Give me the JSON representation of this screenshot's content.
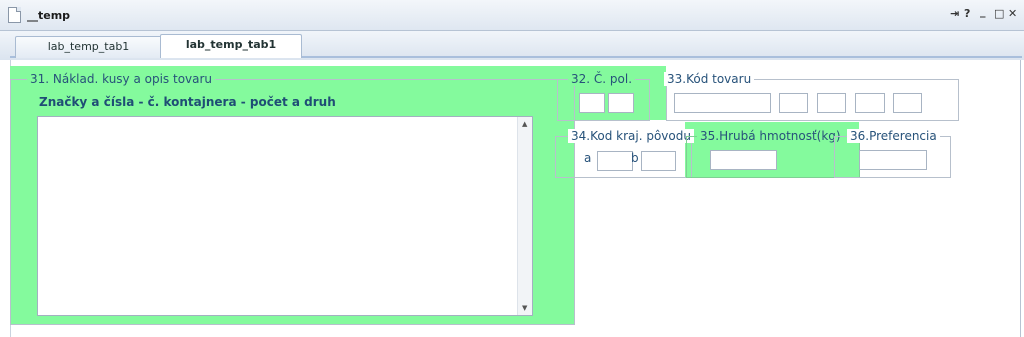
{
  "window": {
    "title": "__temp",
    "controls": [
      "⇥",
      "?",
      "_",
      "□",
      "✕"
    ]
  },
  "tabs": [
    {
      "label": "lab_temp_tab1",
      "active": false
    },
    {
      "label": "lab_temp_tab1",
      "active": true
    }
  ],
  "form": {
    "box31": {
      "legend": "31. Náklad. kusy a opis tovaru",
      "sublabel": "Značky a čísla - č. kontajnera - počet a druh",
      "value": ""
    },
    "box32": {
      "legend": "32. Č. pol."
    },
    "box33": {
      "legend": "33.Kód tovaru"
    },
    "box34": {
      "legend": "34.Kod kraj. pôvodu",
      "a_label": "a",
      "b_label": "b"
    },
    "box35": {
      "legend": "35.Hrubá hmotnosť(kg)"
    },
    "box36": {
      "legend": "36.Preferencia"
    }
  },
  "colors": {
    "highlight": "#84fa9d",
    "border": "#b7c0cc",
    "text": "#27527a"
  },
  "icons": [
    "document-icon",
    "pin-icon",
    "help-icon",
    "minimize-icon",
    "maximize-icon",
    "close-icon",
    "scroll-up-arrow-icon",
    "scroll-down-arrow-icon"
  ]
}
